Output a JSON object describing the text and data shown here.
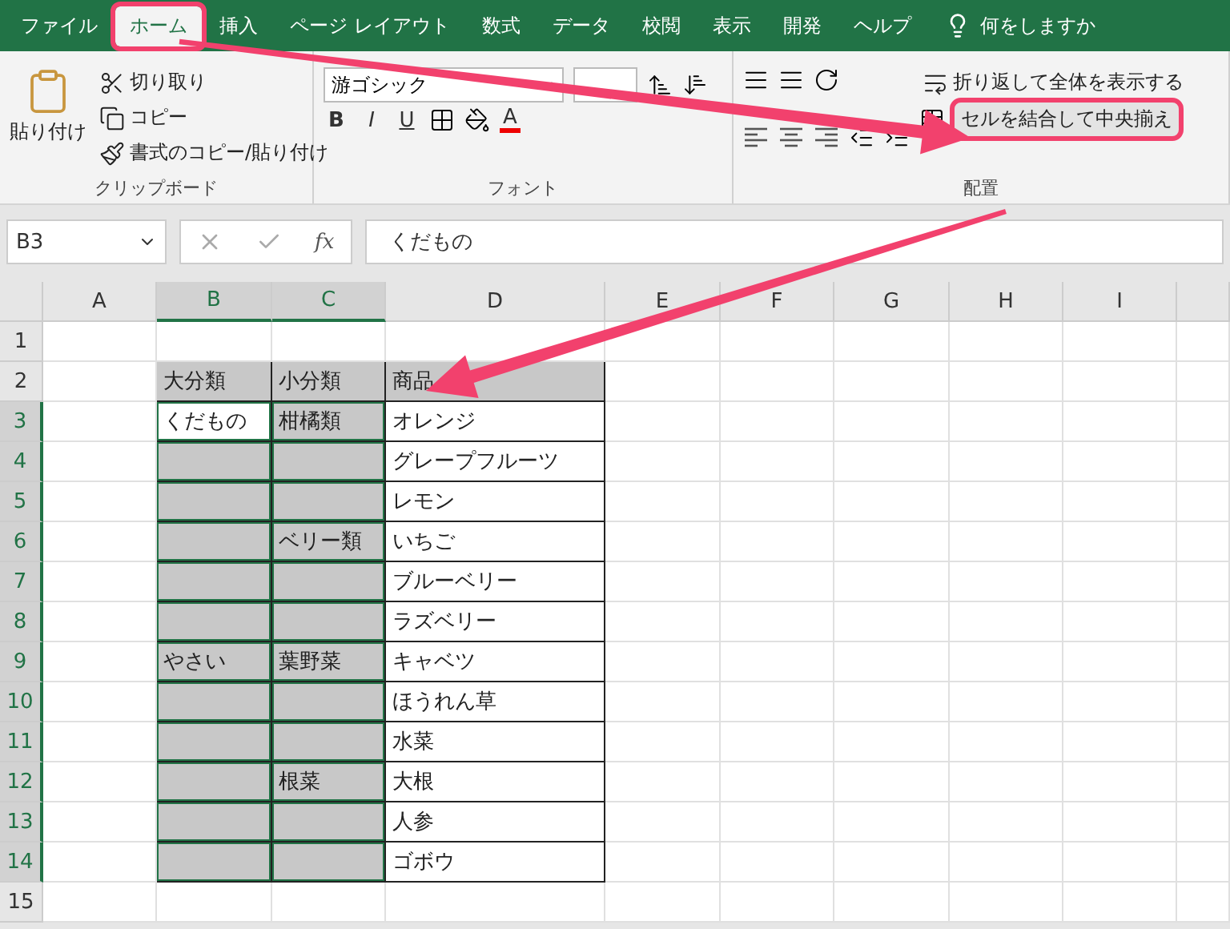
{
  "tabs": [
    {
      "label": "ファイル",
      "selected": false,
      "highlighted": false
    },
    {
      "label": "ホーム",
      "selected": true,
      "highlighted": true
    },
    {
      "label": "挿入",
      "selected": false,
      "highlighted": false
    },
    {
      "label": "ページ レイアウト",
      "selected": false,
      "highlighted": false
    },
    {
      "label": "数式",
      "selected": false,
      "highlighted": false
    },
    {
      "label": "データ",
      "selected": false,
      "highlighted": false
    },
    {
      "label": "校閲",
      "selected": false,
      "highlighted": false
    },
    {
      "label": "表示",
      "selected": false,
      "highlighted": false
    },
    {
      "label": "開発",
      "selected": false,
      "highlighted": false
    },
    {
      "label": "ヘルプ",
      "selected": false,
      "highlighted": false
    }
  ],
  "tell_me": "何をしますか",
  "clipboard": {
    "paste": "貼り付け",
    "cut": "切り取り",
    "copy": "コピー",
    "format_painter": "書式のコピー/貼り付け",
    "label": "クリップボード"
  },
  "font": {
    "name": "游ゴシック",
    "bold": "B",
    "italic": "I",
    "underline": "U",
    "font_color": "A",
    "label": "フォント"
  },
  "alignment": {
    "wrap_text": "折り返して全体を表示する",
    "merge_center": "セルを結合して中央揃え",
    "merge_highlighted": true,
    "label": "配置"
  },
  "formula_bar": {
    "name_box": "B3",
    "fx": "fx",
    "value": "くだもの"
  },
  "columns": [
    {
      "label": "A",
      "selected": false
    },
    {
      "label": "B",
      "selected": true
    },
    {
      "label": "C",
      "selected": true
    },
    {
      "label": "D",
      "selected": false
    },
    {
      "label": "E",
      "selected": false
    },
    {
      "label": "F",
      "selected": false
    },
    {
      "label": "G",
      "selected": false
    },
    {
      "label": "H",
      "selected": false
    },
    {
      "label": "I",
      "selected": false
    }
  ],
  "rows": [
    {
      "label": "1",
      "selected": false
    },
    {
      "label": "2",
      "selected": false,
      "b": {
        "text": "大分類",
        "shaded": true
      },
      "c": {
        "text": "小分類",
        "shaded": true
      },
      "d": {
        "text": "商品",
        "shaded": true
      }
    },
    {
      "label": "3",
      "selected": true,
      "b": {
        "text": "くだもの",
        "shaded": false
      },
      "c": {
        "text": "柑橘類",
        "shaded": true
      },
      "d": {
        "text": "オレンジ",
        "shaded": false
      }
    },
    {
      "label": "4",
      "selected": true,
      "b": {
        "shaded": true
      },
      "c": {
        "shaded": true
      },
      "d": {
        "text": "グレープフルーツ",
        "shaded": false
      }
    },
    {
      "label": "5",
      "selected": true,
      "b": {
        "shaded": true
      },
      "c": {
        "shaded": true
      },
      "d": {
        "text": "レモン",
        "shaded": false
      }
    },
    {
      "label": "6",
      "selected": true,
      "b": {
        "shaded": true
      },
      "c": {
        "text": "ベリー類",
        "shaded": true
      },
      "d": {
        "text": "いちご",
        "shaded": false
      }
    },
    {
      "label": "7",
      "selected": true,
      "b": {
        "shaded": true
      },
      "c": {
        "shaded": true
      },
      "d": {
        "text": "ブルーベリー",
        "shaded": false
      }
    },
    {
      "label": "8",
      "selected": true,
      "b": {
        "shaded": true
      },
      "c": {
        "shaded": true
      },
      "d": {
        "text": "ラズベリー",
        "shaded": false
      }
    },
    {
      "label": "9",
      "selected": true,
      "b": {
        "text": "やさい",
        "shaded": true
      },
      "c": {
        "text": "葉野菜",
        "shaded": true
      },
      "d": {
        "text": "キャベツ",
        "shaded": false
      }
    },
    {
      "label": "10",
      "selected": true,
      "b": {
        "shaded": true
      },
      "c": {
        "shaded": true
      },
      "d": {
        "text": "ほうれん草",
        "shaded": false
      }
    },
    {
      "label": "11",
      "selected": true,
      "b": {
        "shaded": true
      },
      "c": {
        "shaded": true
      },
      "d": {
        "text": "水菜",
        "shaded": false
      }
    },
    {
      "label": "12",
      "selected": true,
      "b": {
        "shaded": true
      },
      "c": {
        "text": "根菜",
        "shaded": true
      },
      "d": {
        "text": "大根",
        "shaded": false
      }
    },
    {
      "label": "13",
      "selected": true,
      "b": {
        "shaded": true
      },
      "c": {
        "shaded": true
      },
      "d": {
        "text": "人参",
        "shaded": false
      }
    },
    {
      "label": "14",
      "selected": true,
      "b": {
        "shaded": true
      },
      "c": {
        "shaded": true
      },
      "d": {
        "text": "ゴボウ",
        "shaded": false
      }
    },
    {
      "label": "15",
      "selected": false
    }
  ]
}
